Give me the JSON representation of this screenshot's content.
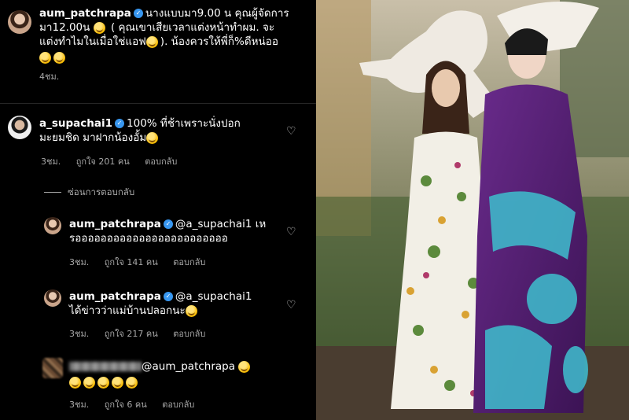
{
  "post": {
    "username": "aum_patchrapa",
    "caption_line1": "นางแบบมา9.00 น คุณผู้จัดการ",
    "caption_line2": "มา12.00น",
    "caption_line2b": "( คุณเขาเสียเวลาแต่งหน้าทำผม. จะ",
    "caption_line3": "แต่งทำไมในเมื่อใช่แอฟ",
    "caption_line3b": "). น้องควรให้พี่ก็%ดีหน่ออ",
    "time": "4ชม."
  },
  "comments": [
    {
      "username": "a_supachai1",
      "text_line1": "100% ที่ช้าเพราะนั่งปอก",
      "text_line2": "มะยมชิด มาฝากน้องอั้ม",
      "time": "3ชม.",
      "likes": "ถูกใจ 201 คน",
      "reply_label": "ตอบกลับ"
    }
  ],
  "hide_replies_label": "ซ่อนการตอบกลับ",
  "replies": [
    {
      "username": "aum_patchrapa",
      "mention": "@a_supachai1",
      "text_suffix": " เห",
      "text_line2": "รออออออออออออออออออออออออ",
      "time": "3ชม.",
      "likes": "ถูกใจ 141 คน",
      "reply_label": "ตอบกลับ"
    },
    {
      "username": "aum_patchrapa",
      "mention": "@a_supachai1",
      "text_line2": "ได้ข่าวว่าแม่บ้านปลอกนะ",
      "time": "3ชม.",
      "likes": "ถูกใจ 217 คน",
      "reply_label": "ตอบกลับ"
    },
    {
      "mention": "@aum_patchrapa",
      "time": "3ชม.",
      "likes": "ถูกใจ 6 คน",
      "reply_label": "ตอบกลับ"
    }
  ],
  "icons": {
    "like": "heart-outline-icon",
    "verified": "verified-badge-icon",
    "emoji": "emoji-icon"
  },
  "colors": {
    "verified": "#3897f0",
    "meta": "#a8a8a8",
    "background": "#000000"
  }
}
